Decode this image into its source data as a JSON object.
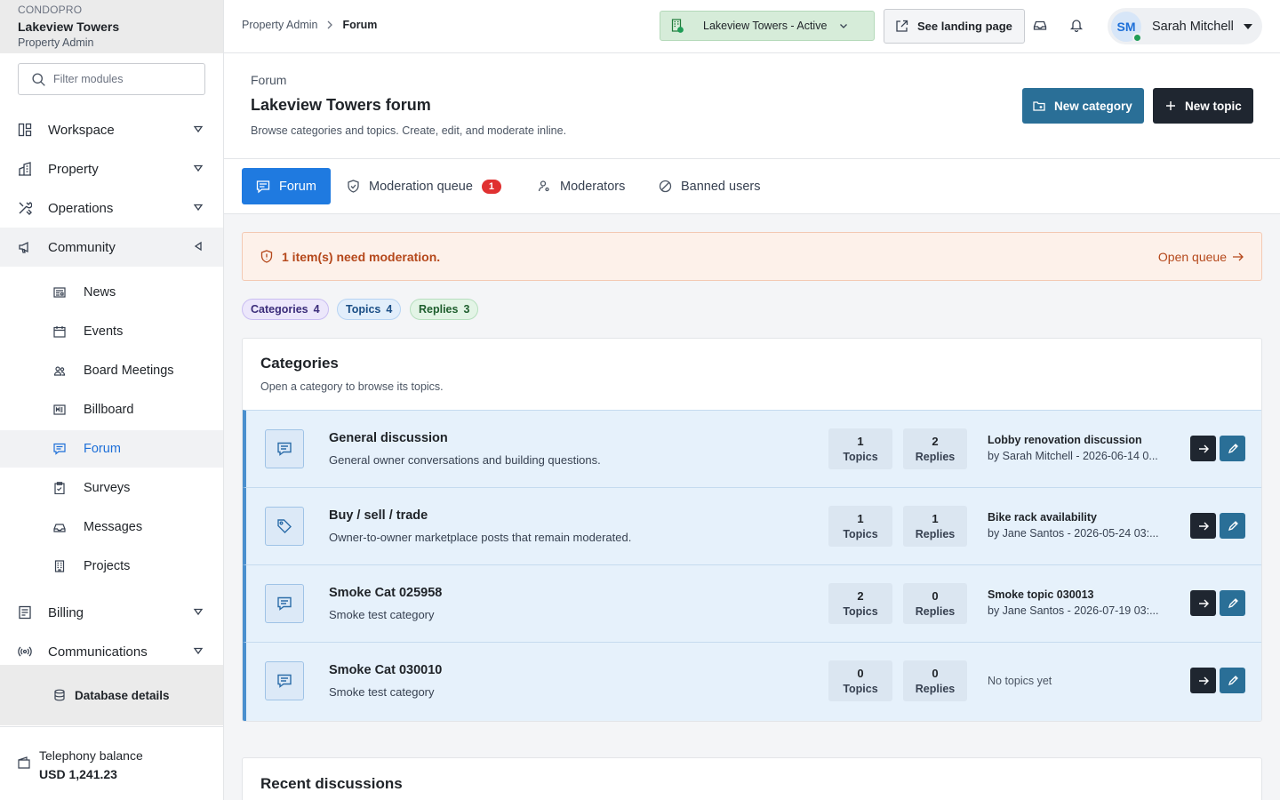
{
  "brand": {
    "sup": "CONDOPRO",
    "name": "Lakeview Towers",
    "role": "Property Admin"
  },
  "sidebar": {
    "filter_placeholder": "Filter modules",
    "groups": [
      {
        "label": "Workspace",
        "icon": "layout-icon"
      },
      {
        "label": "Property",
        "icon": "building-icon"
      },
      {
        "label": "Operations",
        "icon": "tools-icon"
      },
      {
        "label": "Community",
        "icon": "megaphone-icon"
      }
    ],
    "community_items": [
      {
        "label": "News",
        "icon": "newspaper-icon"
      },
      {
        "label": "Events",
        "icon": "calendar-icon"
      },
      {
        "label": "Board Meetings",
        "icon": "users-icon"
      },
      {
        "label": "Billboard",
        "icon": "billboard-icon"
      },
      {
        "label": "Forum",
        "icon": "chat-icon"
      },
      {
        "label": "Surveys",
        "icon": "clipboard-icon"
      },
      {
        "label": "Messages",
        "icon": "inbox-icon"
      },
      {
        "label": "Projects",
        "icon": "building-icon"
      }
    ],
    "more_groups": [
      {
        "label": "Billing",
        "icon": "receipt-icon"
      },
      {
        "label": "Communications",
        "icon": "broadcast-icon"
      }
    ],
    "db_details": "Database details",
    "telephony_label": "Telephony balance",
    "telephony_value": "USD 1,241.23"
  },
  "topbar": {
    "breadcrumb": [
      "Property Admin",
      "Forum"
    ],
    "property_select": "Lakeview Towers - Active",
    "landing_label": "See landing page",
    "user_initials": "SM",
    "user_name": "Sarah Mitchell"
  },
  "page": {
    "subtitle": "Forum",
    "title": "Lakeview Towers forum",
    "description": "Browse categories and topics. Create, edit, and moderate inline.",
    "new_category": "New category",
    "new_topic": "New topic"
  },
  "tabs": [
    {
      "label": "Forum"
    },
    {
      "label": "Moderation queue",
      "badge": "1"
    },
    {
      "label": "Moderators"
    },
    {
      "label": "Banned users"
    }
  ],
  "alert": {
    "message": "1 item(s) need moderation.",
    "link": "Open queue"
  },
  "pills": {
    "categories": {
      "label": "Categories",
      "count": "4"
    },
    "topics": {
      "label": "Topics",
      "count": "4"
    },
    "replies": {
      "label": "Replies",
      "count": "3"
    }
  },
  "categories": {
    "title": "Categories",
    "description": "Open a category to browse its topics.",
    "topics_label": "Topics",
    "replies_label": "Replies",
    "rows": [
      {
        "name": "General discussion",
        "desc": "General owner conversations and building questions.",
        "icon": "chat-icon",
        "topics": "1",
        "replies": "2",
        "last_title": "Lobby renovation discussion",
        "last_by": "by Sarah Mitchell - 2026-06-14 0..."
      },
      {
        "name": "Buy / sell / trade",
        "desc": "Owner-to-owner marketplace posts that remain moderated.",
        "icon": "tag-icon",
        "topics": "1",
        "replies": "1",
        "last_title": "Bike rack availability",
        "last_by": "by Jane Santos - 2026-05-24 03:..."
      },
      {
        "name": "Smoke Cat 025958",
        "desc": "Smoke test category",
        "icon": "chat-icon",
        "topics": "2",
        "replies": "0",
        "last_title": "Smoke topic 030013",
        "last_by": "by Jane Santos - 2026-07-19 03:..."
      },
      {
        "name": "Smoke Cat 030010",
        "desc": "Smoke test category",
        "icon": "chat-icon",
        "topics": "0",
        "replies": "0",
        "last_title": "",
        "last_by": "",
        "empty_text": "No topics yet"
      }
    ]
  },
  "recent": {
    "title": "Recent discussions"
  }
}
